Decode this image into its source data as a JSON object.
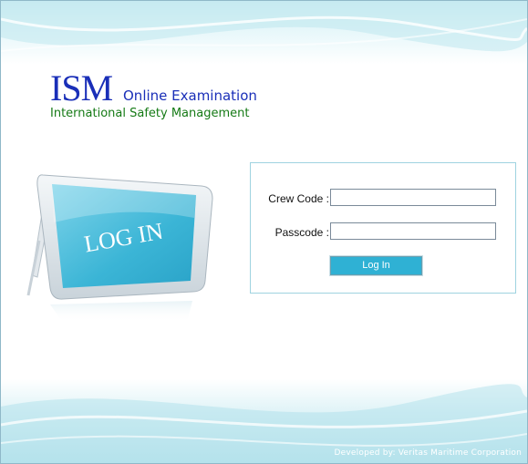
{
  "header": {
    "logo_main": "ISM",
    "logo_sub": "Online Examination",
    "tagline": "International Safety Management"
  },
  "sign": {
    "text": "LOG IN",
    "icon": "login-sign-illustration"
  },
  "form": {
    "crew_code_label": "Crew Code :",
    "crew_code_value": "",
    "passcode_label": "Passcode :",
    "passcode_value": "",
    "submit_label": "Log In"
  },
  "footer": {
    "credit": "Developed by: Veritas Maritime Corporation"
  },
  "colors": {
    "brand_blue": "#1a2fb8",
    "tagline_green": "#157a15",
    "button_cyan": "#2fb1d4",
    "box_border": "#9fd3e0"
  }
}
